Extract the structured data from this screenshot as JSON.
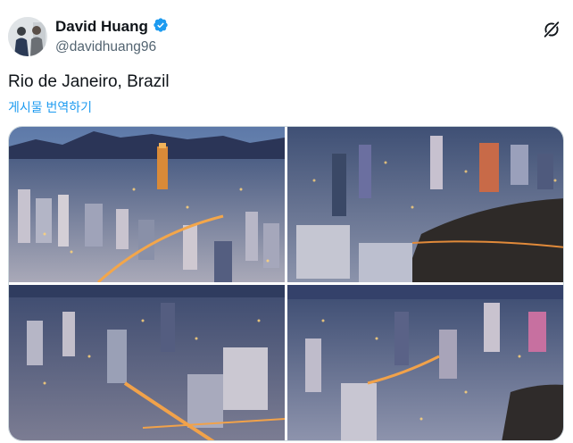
{
  "author": {
    "display_name": "David Huang",
    "handle": "@davidhuang96",
    "verified_icon": "verified-badge-icon",
    "accent": "#1d9bf0"
  },
  "tweet": {
    "text": "Rio de Janeiro, Brazil",
    "translate_label": "게시물 번역하기"
  },
  "media": {
    "photo_count": 4,
    "photos": [
      {
        "alt": "city-night-skyline-photo-1"
      },
      {
        "alt": "city-night-skyline-photo-2"
      },
      {
        "alt": "city-night-skyline-photo-3"
      },
      {
        "alt": "city-night-skyline-photo-4"
      }
    ]
  },
  "actions": {
    "grok_icon": "grok-icon"
  }
}
